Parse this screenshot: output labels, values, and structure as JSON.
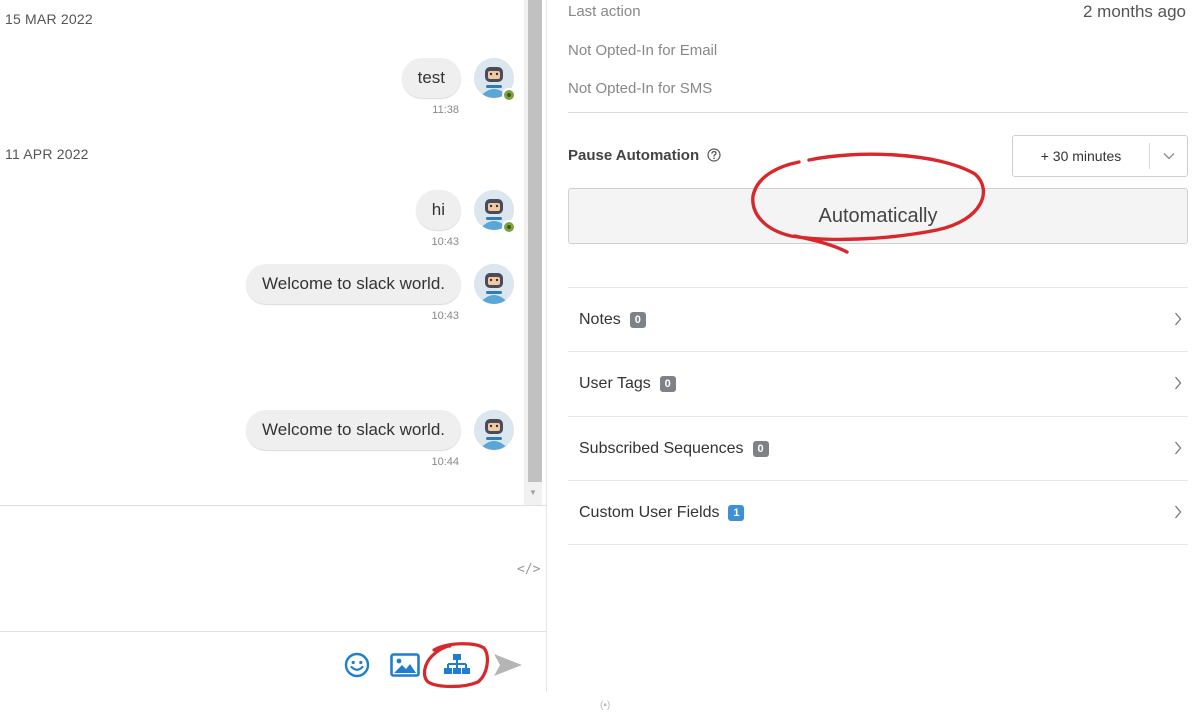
{
  "chat": {
    "date_separators": [
      "15 MAR 2022",
      "11 APR 2022"
    ],
    "messages": [
      {
        "text": "test",
        "time": "11:38",
        "badge": true
      },
      {
        "text": "hi",
        "time": "10:43",
        "badge": true
      },
      {
        "text": "Welcome to slack world.",
        "time": "10:43",
        "badge": false
      },
      {
        "text": "Welcome to slack world.",
        "time": "10:44",
        "badge": false
      }
    ],
    "code_toggle": "</>",
    "toolbar": {
      "emoji": "emoji-icon",
      "image": "image-icon",
      "flow": "flow-icon",
      "send": "send-icon"
    }
  },
  "info": {
    "last_action_label": "Last action",
    "last_action_value": "2 months ago",
    "email_status": "Not Opted-In for Email",
    "sms_status": "Not Opted-In for SMS",
    "pause_label": "Pause Automation",
    "duration_value": "+ 30 minutes",
    "automation_mode": "Automatically",
    "sections": [
      {
        "label": "Notes",
        "count": "0"
      },
      {
        "label": "User Tags",
        "count": "0"
      },
      {
        "label": "Subscribed Sequences",
        "count": "0"
      },
      {
        "label": "Custom User Fields",
        "count": "1"
      }
    ]
  },
  "colors": {
    "annotation_red": "#d8282c",
    "count_badge": "#7d8288",
    "count_badge_active": "#3f8fd8",
    "icon_blue": "#1e7fd0",
    "send_gray": "#b5b5b5"
  },
  "footer_mark": "(▪)"
}
